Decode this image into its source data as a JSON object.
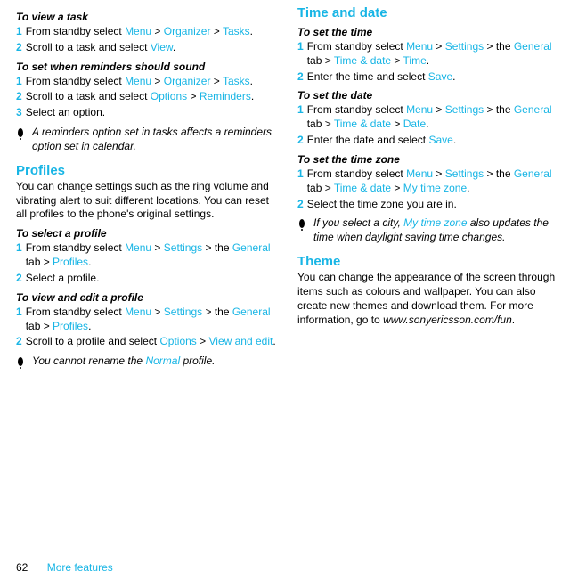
{
  "footer": {
    "page": "62",
    "section": "More features"
  },
  "col1": {
    "viewTask": {
      "title": "To view a task",
      "step1_pre": "From standby select ",
      "menu": "Menu",
      "gt": " > ",
      "organizer": "Organizer",
      "tasks": "Tasks",
      "period": ".",
      "step2_pre": "Scroll to a task and select ",
      "view": "View"
    },
    "reminders": {
      "title": "To set when reminders should sound",
      "step1_pre": "From standby select ",
      "step2_pre": "Scroll to a task and select ",
      "options": "Options",
      "remLink": "Reminders",
      "step3": "Select an option."
    },
    "note1": "A reminders option set in tasks affects a reminders option set in calendar.",
    "profiles": {
      "heading": "Profiles",
      "intro": "You can change settings such as the ring volume and vibrating alert to suit different locations. You can reset all profiles to the phone's original settings.",
      "select": {
        "title": "To select a profile",
        "step1_pre": "From standby select ",
        "settings": "Settings",
        "the": " > the ",
        "general": "General",
        "tabword": " tab > ",
        "profilesLink": "Profiles",
        "step2": "Select a profile."
      },
      "edit": {
        "title": "To view and edit a profile",
        "step2_pre": "Scroll to a profile and select ",
        "options": "Options",
        "viewedit": "View and edit"
      }
    },
    "note2_pre": "You cannot rename the ",
    "note2_link": "Normal",
    "note2_post": " profile."
  },
  "col2": {
    "timedate": {
      "heading": "Time and date",
      "settime": {
        "title": "To set the time",
        "step1_pre": "From standby select ",
        "timedateLink": "Time & date",
        "timeLink": "Time",
        "step2_pre": "Enter the time and select ",
        "save": "Save"
      },
      "setdate": {
        "title": "To set the date",
        "dateLink": "Date",
        "step2_pre": "Enter the date and select "
      },
      "setzone": {
        "title": "To set the time zone",
        "zoneLink": "My time zone",
        "step2": "Select the time zone you are in."
      },
      "note_pre": "If you select a city, ",
      "note_link": "My time zone",
      "note_post": " also updates the time when daylight saving time changes."
    },
    "theme": {
      "heading": "Theme",
      "intro_pre": "You can change the appearance of the screen through items such as colours and wallpaper. You can also create new themes and download them. For more information, go to ",
      "url": "www.sonyericsson.com/fun",
      "intro_post": "."
    },
    "shared": {
      "menu": "Menu",
      "settings": "Settings",
      "general": "General"
    }
  }
}
